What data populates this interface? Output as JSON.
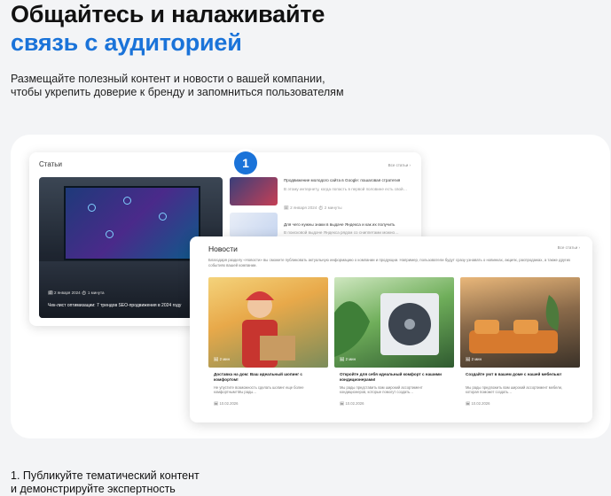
{
  "heading": {
    "line1": "Общайтесь и налаживайте",
    "line2": "связь с аудиторией"
  },
  "lead": {
    "line1": "Размещайте полезный контент и новости о вашей компании,",
    "line2": "чтобы укрепить доверие к бренду и запомниться пользователям"
  },
  "badge": "1",
  "articles": {
    "title": "Статьи",
    "all_link": "Все статьи ›",
    "hero_meta": "🗓 2 января 2024   ⏱ 1 минута",
    "hero_caption": "Чек-лист оптимизации: 7 трендов SEO-продвижения в 2024 году",
    "side": [
      {
        "title": "Продвижение молодого сайта в Google: пошаговая стратегия",
        "desc": "В этому интернету, когда попасть в первой половине есть свой…",
        "meta": "🗓 2 января 2024   ⏱ 2 минуты"
      },
      {
        "title": "Для чего нужны знаки в выдаче Яндекса и как их получить",
        "desc": "В поисковой выдаче Яндекса рядом со сниппетами можно…",
        "meta": ""
      }
    ]
  },
  "news": {
    "title": "Новости",
    "all_link": "Все статьи ›",
    "subtitle": "Благодаря разделу «Новости» вы сможете публиковать актуальную информацию о компании и продукции. Например, пользователи будут сразу узнавать о новинках, акциях, распродажах, а также других событиях вашей компании.",
    "items": [
      {
        "stamp": "🖼 2 мин",
        "title": "Доставка на дом: Ваш идеальный шопинг с комфортом!",
        "body": "Не упустите возможность сделать шопинг еще более комфортным! Мы рады…",
        "date": "🗓 10.02.2026"
      },
      {
        "stamp": "🖼 2 мин",
        "title": "Откройте для себя идеальный комфорт с нашими кондиционерами!",
        "body": "Мы рады представить вам широкий ассортимент кондиционеров, которые помогут создать…",
        "date": "🗓 10.02.2026"
      },
      {
        "stamp": "🖼 2 мин",
        "title": "Создайте уют в вашем доме с нашей мебелью!",
        "body": "Мы рады предложить вам широкий ассортимент мебели, которая поможет создать…",
        "date": "🗓 10.02.2026"
      }
    ]
  },
  "footer": {
    "line1": "1. Публикуйте тематический контент",
    "line2": "и демонстрируйте экспертность"
  }
}
